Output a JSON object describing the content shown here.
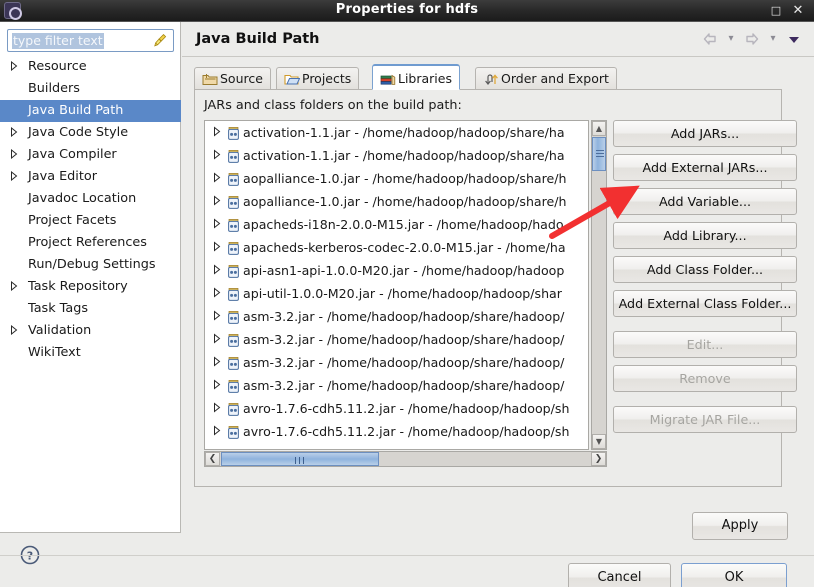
{
  "window": {
    "title": "Properties for hdfs",
    "app_icon": "gear-icon",
    "maximize_label": "□",
    "close_label": "✕"
  },
  "sidebar": {
    "filter": {
      "value": "type filter text",
      "placeholder": "type filter text",
      "clear_icon": "broom-icon"
    },
    "items": [
      {
        "label": "Resource",
        "expandable": true,
        "selected": false
      },
      {
        "label": "Builders",
        "expandable": false,
        "selected": false
      },
      {
        "label": "Java Build Path",
        "expandable": false,
        "selected": true
      },
      {
        "label": "Java Code Style",
        "expandable": true,
        "selected": false
      },
      {
        "label": "Java Compiler",
        "expandable": true,
        "selected": false
      },
      {
        "label": "Java Editor",
        "expandable": true,
        "selected": false
      },
      {
        "label": "Javadoc Location",
        "expandable": false,
        "selected": false
      },
      {
        "label": "Project Facets",
        "expandable": false,
        "selected": false
      },
      {
        "label": "Project References",
        "expandable": false,
        "selected": false
      },
      {
        "label": "Run/Debug Settings",
        "expandable": false,
        "selected": false
      },
      {
        "label": "Task Repository",
        "expandable": true,
        "selected": false
      },
      {
        "label": "Task Tags",
        "expandable": false,
        "selected": false
      },
      {
        "label": "Validation",
        "expandable": true,
        "selected": false
      },
      {
        "label": "WikiText",
        "expandable": false,
        "selected": false
      }
    ],
    "help_icon": "help-question-icon"
  },
  "page": {
    "title": "Java Build Path",
    "nav": {
      "back_icon": "back-arrow-icon",
      "back_menu_icon": "chevron-down-icon",
      "forward_icon": "forward-arrow-icon",
      "forward_menu_icon": "chevron-down-icon",
      "view_menu_icon": "triangle-down-icon"
    },
    "tabs": [
      {
        "label": "Source",
        "icon": "source-folder-icon",
        "active": false
      },
      {
        "label": "Projects",
        "icon": "projects-folder-icon",
        "active": false
      },
      {
        "label": "Libraries",
        "icon": "libraries-books-icon",
        "active": true
      },
      {
        "label": "Order and Export",
        "icon": "order-export-icon",
        "active": false
      }
    ],
    "pane_label": "JARs and class folders on the build path:",
    "jar_entries": [
      "activation-1.1.jar - /home/hadoop/hadoop/share/ha",
      "activation-1.1.jar - /home/hadoop/hadoop/share/ha",
      "aopalliance-1.0.jar - /home/hadoop/hadoop/share/h",
      "aopalliance-1.0.jar - /home/hadoop/hadoop/share/h",
      "apacheds-i18n-2.0.0-M15.jar - /home/hadoop/hado",
      "apacheds-kerberos-codec-2.0.0-M15.jar - /home/ha",
      "api-asn1-api-1.0.0-M20.jar - /home/hadoop/hadoop",
      "api-util-1.0.0-M20.jar - /home/hadoop/hadoop/shar",
      "asm-3.2.jar - /home/hadoop/hadoop/share/hadoop/",
      "asm-3.2.jar - /home/hadoop/hadoop/share/hadoop/",
      "asm-3.2.jar - /home/hadoop/hadoop/share/hadoop/",
      "asm-3.2.jar - /home/hadoop/hadoop/share/hadoop/",
      "avro-1.7.6-cdh5.11.2.jar - /home/hadoop/hadoop/sh",
      "avro-1.7.6-cdh5.11.2.jar - /home/hadoop/hadoop/sh"
    ],
    "jar_icon": "jar-file-icon",
    "expander_icon": "triangle-right-icon",
    "buttons": [
      {
        "label": "Add JARs...",
        "enabled": true
      },
      {
        "label": "Add External JARs...",
        "enabled": true
      },
      {
        "label": "Add Variable...",
        "enabled": true
      },
      {
        "label": "Add Library...",
        "enabled": true
      },
      {
        "label": "Add Class Folder...",
        "enabled": true
      },
      {
        "label": "Add External Class Folder...",
        "enabled": true
      },
      {
        "label": "Edit...",
        "enabled": false
      },
      {
        "label": "Remove",
        "enabled": false
      },
      {
        "label": "Migrate JAR File...",
        "enabled": false
      }
    ],
    "scrollbars": {
      "v_up_icon": "chevron-up-icon",
      "v_down_icon": "chevron-down-icon",
      "h_left_icon": "chevron-left-icon",
      "h_right_icon": "chevron-right-icon"
    }
  },
  "footer": {
    "apply_label": "Apply",
    "cancel_label": "Cancel",
    "ok_label": "OK"
  },
  "annotation": {
    "arrow_color": "#f23030",
    "arrow_target": "Add External JARs..."
  }
}
